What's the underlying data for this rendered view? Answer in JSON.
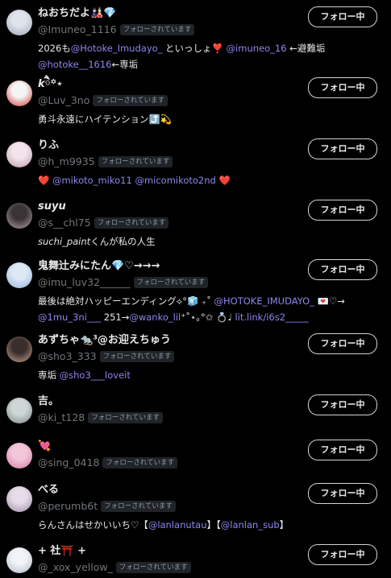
{
  "follow_label": "フォロー中",
  "followed_badge": "フォローされています",
  "users": [
    {
      "name": "ねおちだよ",
      "name_suffix": "🎎💎",
      "handle": "@Imuneo_1116",
      "bio_parts": [
        {
          "t": "2026も",
          "link": false
        },
        {
          "t": "@Hotoke_Imudayo_",
          "link": true
        },
        {
          "t": " といっしょ",
          "link": false
        },
        {
          "t": "❣️",
          "link": false,
          "cls": "heart"
        },
        {
          "t": " ",
          "link": false
        },
        {
          "t": "@imuneo_16",
          "link": true
        },
        {
          "t": " ←避難垢",
          "link": false
        },
        {
          "br": true
        },
        {
          "t": "@hotoke__1616",
          "link": true
        },
        {
          "t": "←専垢",
          "link": false
        }
      ],
      "avatar_colors": [
        "#dfe3ea",
        "#9aa4b8"
      ]
    },
    {
      "name": "k",
      "name_suffix": "ཻ꙳⋆",
      "handle": "@Luv_3no",
      "bio_parts": [
        {
          "t": "勇斗永遠にハイテンション",
          "link": false
        },
        {
          "t": "⤴️",
          "link": false,
          "cls": "tag-emoji"
        },
        {
          "t": "💫",
          "link": false
        }
      ],
      "avatar_colors": [
        "#f4f4f4",
        "#c8352f"
      ]
    },
    {
      "name": "りふ",
      "name_suffix": "",
      "handle": "@h_m9935",
      "bio_parts": [
        {
          "t": "❤️",
          "link": false,
          "cls": "heart"
        },
        {
          "t": " ",
          "link": false
        },
        {
          "t": "@mikoto_miko11",
          "link": true
        },
        {
          "t": " ",
          "link": false
        },
        {
          "t": "@micomikoto2nd",
          "link": true
        },
        {
          "t": " ",
          "link": false
        },
        {
          "t": "❤️",
          "link": false,
          "cls": "heart"
        }
      ],
      "avatar_colors": [
        "#f3e3ea",
        "#b89aa8"
      ]
    },
    {
      "name": "suyu",
      "name_suffix": "",
      "handle": "@s__chl75",
      "bio_parts": [
        {
          "t": "suchi_paint",
          "link": false
        },
        {
          "t": "くんが私の人生",
          "link": false
        }
      ],
      "avatar_colors": [
        "#3a3438",
        "#b9a6a6"
      ]
    },
    {
      "name": "鬼舞辻みにたん",
      "name_suffix": "💎♡→→→",
      "handle": "@imu_luv32______",
      "bio_parts": [
        {
          "t": "最後は絶対ハッピーエンディング⟡°🧊 ₊˚ ",
          "link": false
        },
        {
          "t": "@HOTOKE_IMUDAYO_",
          "link": true
        },
        {
          "t": " 💌♡→",
          "link": false
        },
        {
          "br": true
        },
        {
          "t": "@1mu_3ni___",
          "link": true
        },
        {
          "t": " 251→",
          "link": false
        },
        {
          "t": "@wanko_lil",
          "link": true
        },
        {
          "t": "⁺˚⋆｡°✩ 💍♩ ",
          "link": false
        },
        {
          "t": "lit.link/i6s2_____",
          "link": true
        }
      ],
      "avatar_colors": [
        "#dce8f4",
        "#8fb2d6"
      ]
    },
    {
      "name": "あずちゃ",
      "name_suffix": "🐀³@お迎えちゅう",
      "handle": "@sho3_333",
      "bio_parts": [
        {
          "t": "専垢 ",
          "link": false
        },
        {
          "t": "@sho3___loveit",
          "link": true
        }
      ],
      "avatar_colors": [
        "#3a2e2c",
        "#caa58f"
      ]
    },
    {
      "name": "吉。",
      "name_suffix": "",
      "handle": "@ki_t128",
      "bio_parts": [],
      "avatar_colors": [
        "#cfd6d6",
        "#7a8686"
      ]
    },
    {
      "name": "",
      "name_suffix": "💘",
      "handle": "@sing_0418",
      "bio_parts": [],
      "avatar_colors": [
        "#f0c6d8",
        "#d87aa4"
      ]
    },
    {
      "name": "べる",
      "name_suffix": "",
      "handle": "@perumb6t",
      "bio_parts": [
        {
          "t": "らんさんはせかいいち♡【",
          "link": false
        },
        {
          "t": "@lanlanutau",
          "link": true
        },
        {
          "t": "】【",
          "link": false
        },
        {
          "t": "@lanlan_sub",
          "link": true
        },
        {
          "t": "】",
          "link": false
        }
      ],
      "avatar_colors": [
        "#e6dbe8",
        "#9c8ba6"
      ]
    },
    {
      "name": "+ 社",
      "name_suffix": "⛩️ +",
      "handle": "@_xox_yellow_",
      "bio_parts": [],
      "avatar_colors": [
        "#f1f3f6",
        "#aeb8c6"
      ]
    }
  ]
}
